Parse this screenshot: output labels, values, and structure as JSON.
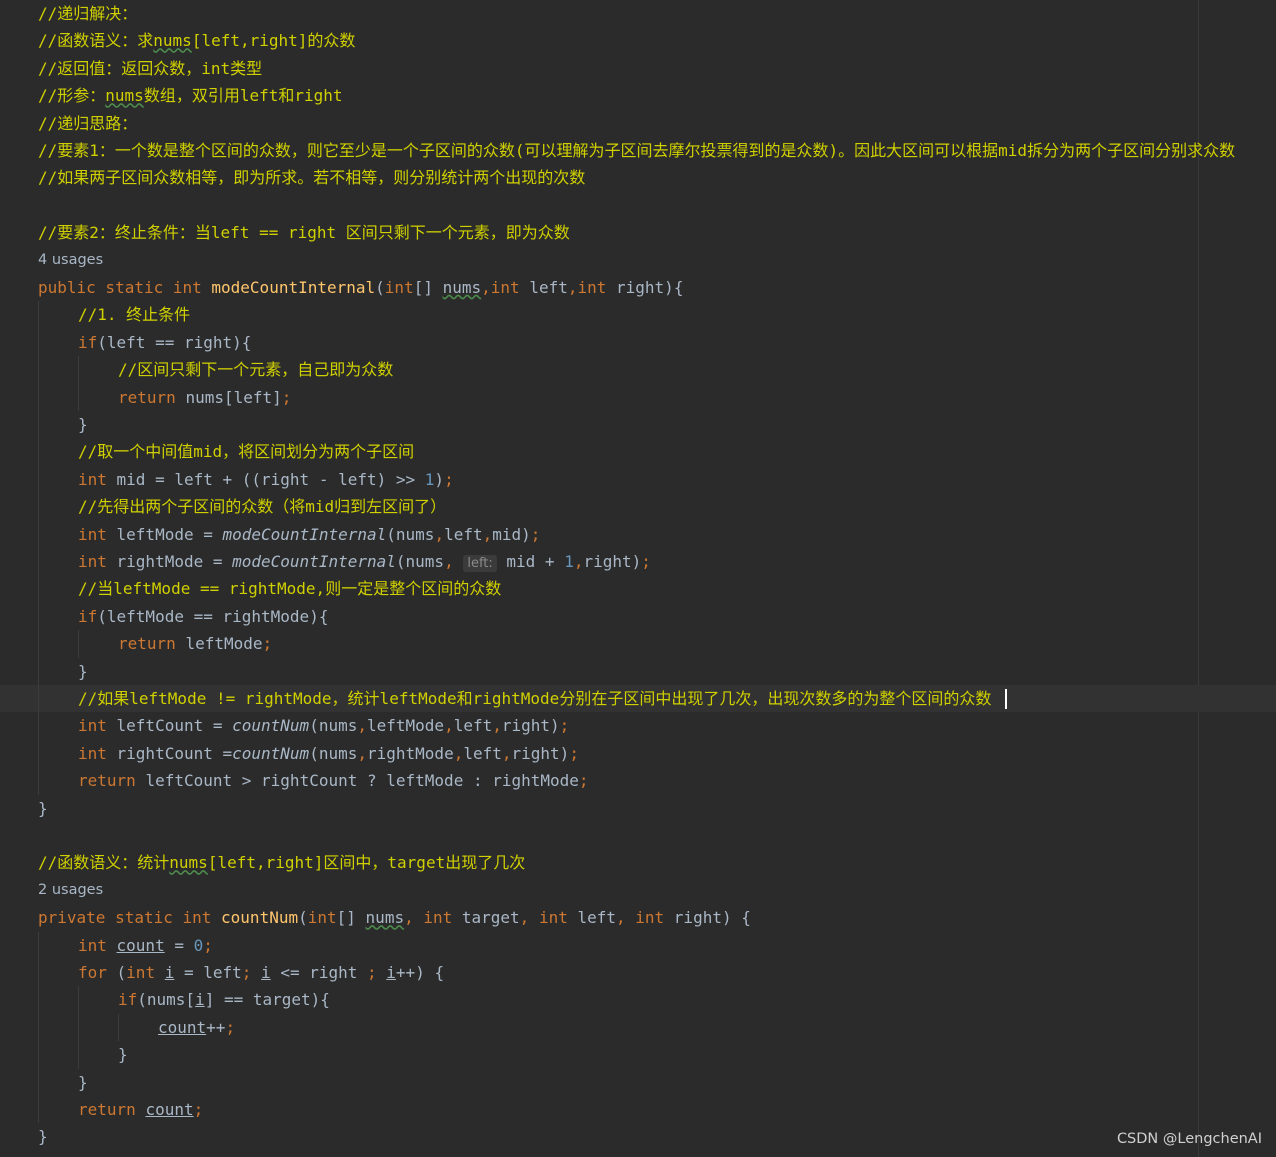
{
  "editor": {
    "lines": [
      {
        "indent": 0,
        "tokens": [
          [
            "comment",
            "//递归解决：\n"
          ]
        ]
      },
      {
        "indent": 0,
        "tokens": [
          [
            "comment",
            "//函数语义：求"
          ],
          [
            "comment-typo",
            "nums"
          ],
          [
            "comment",
            "[left,right]的众数"
          ]
        ]
      },
      {
        "indent": 0,
        "tokens": [
          [
            "comment",
            "//返回值：返回众数，int类型"
          ]
        ]
      },
      {
        "indent": 0,
        "tokens": [
          [
            "comment",
            "//形参："
          ],
          [
            "comment-typo",
            "nums"
          ],
          [
            "comment",
            "数组，双引用left和right"
          ]
        ]
      },
      {
        "indent": 0,
        "tokens": [
          [
            "comment",
            "//递归思路："
          ]
        ]
      },
      {
        "indent": 0,
        "tokens": [
          [
            "comment",
            "//要素1：一个数是整个区间的众数，则它至少是一个子区间的众数(可以理解为子区间去摩尔投票得到的是众数)。因此大区间可以根据mid拆分为两个子区间分别求众数"
          ]
        ]
      },
      {
        "indent": 0,
        "tokens": [
          [
            "comment",
            "//如果两子区间众数相等，即为所求。若不相等，则分别统计两个出现的次数"
          ]
        ]
      },
      {
        "indent": 0,
        "tokens": []
      },
      {
        "indent": 0,
        "tokens": [
          [
            "comment",
            "//要素2：终止条件：当left == right 区间只剩下一个元素，即为众数"
          ]
        ]
      },
      {
        "indent": 0,
        "inlay": true,
        "tokens": [
          [
            "inlay",
            "4 usages"
          ]
        ]
      },
      {
        "indent": 0,
        "tokens": [
          [
            "kw",
            "public static int "
          ],
          [
            "fn",
            "modeCountInternal"
          ],
          [
            "text",
            "("
          ],
          [
            "kw",
            "int"
          ],
          [
            "text",
            "[] "
          ],
          [
            "text-typo",
            "nums"
          ],
          [
            "kw",
            ","
          ],
          [
            "kw",
            "int "
          ],
          [
            "text",
            "left"
          ],
          [
            "kw",
            ","
          ],
          [
            "kw",
            "int "
          ],
          [
            "text",
            "right){"
          ]
        ]
      },
      {
        "indent": 1,
        "tokens": [
          [
            "comment",
            "//1. 终止条件"
          ]
        ]
      },
      {
        "indent": 1,
        "tokens": [
          [
            "kw",
            "if"
          ],
          [
            "text",
            "(left == right){"
          ]
        ]
      },
      {
        "indent": 2,
        "tokens": [
          [
            "comment",
            "//区间只剩下一个元素，自己即为众数"
          ]
        ]
      },
      {
        "indent": 2,
        "tokens": [
          [
            "kw",
            "return "
          ],
          [
            "text",
            "nums[left]"
          ],
          [
            "kw",
            ";"
          ]
        ]
      },
      {
        "indent": 1,
        "tokens": [
          [
            "text",
            "}"
          ]
        ]
      },
      {
        "indent": 1,
        "tokens": [
          [
            "comment",
            "//取一个中间值mid，将区间划分为两个子区间"
          ]
        ]
      },
      {
        "indent": 1,
        "tokens": [
          [
            "kw",
            "int "
          ],
          [
            "text",
            "mid = left + ((right - left) >> "
          ],
          [
            "num",
            "1"
          ],
          [
            "text",
            ")"
          ],
          [
            "kw",
            ";"
          ]
        ]
      },
      {
        "indent": 1,
        "tokens": [
          [
            "comment",
            "//先得出两个子区间的众数（将mid归到左区间了）"
          ]
        ]
      },
      {
        "indent": 1,
        "tokens": [
          [
            "kw",
            "int "
          ],
          [
            "text",
            "leftMode = "
          ],
          [
            "static",
            "modeCountInternal"
          ],
          [
            "text",
            "(nums"
          ],
          [
            "kw",
            ","
          ],
          [
            "text",
            "left"
          ],
          [
            "kw",
            ","
          ],
          [
            "text",
            "mid)"
          ],
          [
            "kw",
            ";"
          ]
        ]
      },
      {
        "indent": 1,
        "tokens": [
          [
            "kw",
            "int "
          ],
          [
            "text",
            "rightMode = "
          ],
          [
            "static",
            "modeCountInternal"
          ],
          [
            "text",
            "(nums"
          ],
          [
            "kw",
            ", "
          ],
          [
            "hint",
            "left:"
          ],
          [
            "text",
            " mid + "
          ],
          [
            "num",
            "1"
          ],
          [
            "kw",
            ","
          ],
          [
            "text",
            "right)"
          ],
          [
            "kw",
            ";"
          ]
        ]
      },
      {
        "indent": 1,
        "tokens": [
          [
            "comment",
            "//当leftMode == rightMode,则一定是整个区间的众数"
          ]
        ]
      },
      {
        "indent": 1,
        "tokens": [
          [
            "kw",
            "if"
          ],
          [
            "text",
            "(leftMode == rightMode){"
          ]
        ]
      },
      {
        "indent": 2,
        "tokens": [
          [
            "kw",
            "return "
          ],
          [
            "text",
            "leftMode"
          ],
          [
            "kw",
            ";"
          ]
        ]
      },
      {
        "indent": 1,
        "tokens": [
          [
            "text",
            "}"
          ]
        ]
      },
      {
        "indent": 1,
        "current": true,
        "tokens": [
          [
            "comment",
            "//如果leftMode != rightMode，统计leftMode和rightMode分别在子区间中出现了几次，出现次数多的为整个区间的众数"
          ]
        ]
      },
      {
        "indent": 1,
        "tokens": [
          [
            "kw",
            "int "
          ],
          [
            "text",
            "leftCount = "
          ],
          [
            "static",
            "countNum"
          ],
          [
            "text",
            "(nums"
          ],
          [
            "kw",
            ","
          ],
          [
            "text",
            "leftMode"
          ],
          [
            "kw",
            ","
          ],
          [
            "text",
            "left"
          ],
          [
            "kw",
            ","
          ],
          [
            "text",
            "right)"
          ],
          [
            "kw",
            ";"
          ]
        ]
      },
      {
        "indent": 1,
        "tokens": [
          [
            "kw",
            "int "
          ],
          [
            "text",
            "rightCount ="
          ],
          [
            "static",
            "countNum"
          ],
          [
            "text",
            "(nums"
          ],
          [
            "kw",
            ","
          ],
          [
            "text",
            "rightMode"
          ],
          [
            "kw",
            ","
          ],
          [
            "text",
            "left"
          ],
          [
            "kw",
            ","
          ],
          [
            "text",
            "right)"
          ],
          [
            "kw",
            ";"
          ]
        ]
      },
      {
        "indent": 1,
        "tokens": [
          [
            "kw",
            "return "
          ],
          [
            "text",
            "leftCount > rightCount ? leftMode : rightMode"
          ],
          [
            "kw",
            ";"
          ]
        ]
      },
      {
        "indent": 0,
        "tokens": [
          [
            "text",
            "}"
          ]
        ]
      },
      {
        "indent": 0,
        "tokens": []
      },
      {
        "indent": 0,
        "tokens": [
          [
            "comment",
            "//函数语义：统计"
          ],
          [
            "comment-typo",
            "nums"
          ],
          [
            "comment",
            "[left,right]区间中，target出现了几次"
          ]
        ]
      },
      {
        "indent": 0,
        "inlay": true,
        "tokens": [
          [
            "inlay",
            "2 usages"
          ]
        ]
      },
      {
        "indent": 0,
        "tokens": [
          [
            "kw",
            "private static int "
          ],
          [
            "fn",
            "countNum"
          ],
          [
            "text",
            "("
          ],
          [
            "kw",
            "int"
          ],
          [
            "text",
            "[] "
          ],
          [
            "text-typo",
            "nums"
          ],
          [
            "kw",
            ", int "
          ],
          [
            "text",
            "target"
          ],
          [
            "kw",
            ", int "
          ],
          [
            "text",
            "left"
          ],
          [
            "kw",
            ", int "
          ],
          [
            "text",
            "right) {"
          ]
        ]
      },
      {
        "indent": 1,
        "tokens": [
          [
            "kw",
            "int "
          ],
          [
            "text-ul",
            "count"
          ],
          [
            "text",
            " = "
          ],
          [
            "num",
            "0"
          ],
          [
            "kw",
            ";"
          ]
        ]
      },
      {
        "indent": 1,
        "tokens": [
          [
            "kw",
            "for "
          ],
          [
            "text",
            "("
          ],
          [
            "kw",
            "int "
          ],
          [
            "text-ul",
            "i"
          ],
          [
            "text",
            " = left"
          ],
          [
            "kw",
            "; "
          ],
          [
            "text-ul",
            "i"
          ],
          [
            "text",
            " <= right "
          ],
          [
            "kw",
            "; "
          ],
          [
            "text-ul",
            "i"
          ],
          [
            "text",
            "++) {"
          ]
        ]
      },
      {
        "indent": 2,
        "tokens": [
          [
            "kw",
            "if"
          ],
          [
            "text",
            "(nums["
          ],
          [
            "text-ul",
            "i"
          ],
          [
            "text",
            "] == target){"
          ]
        ]
      },
      {
        "indent": 3,
        "tokens": [
          [
            "text-ul",
            "count"
          ],
          [
            "text",
            "++"
          ],
          [
            "kw",
            ";"
          ]
        ]
      },
      {
        "indent": 2,
        "tokens": [
          [
            "text",
            "}"
          ]
        ]
      },
      {
        "indent": 1,
        "tokens": [
          [
            "text",
            "}"
          ]
        ]
      },
      {
        "indent": 1,
        "tokens": [
          [
            "kw",
            "return "
          ],
          [
            "text-ul",
            "count"
          ],
          [
            "kw",
            ";"
          ]
        ]
      },
      {
        "indent": 0,
        "tokens": [
          [
            "text",
            "}"
          ]
        ]
      }
    ]
  },
  "watermark": "CSDN @LengchenAI"
}
